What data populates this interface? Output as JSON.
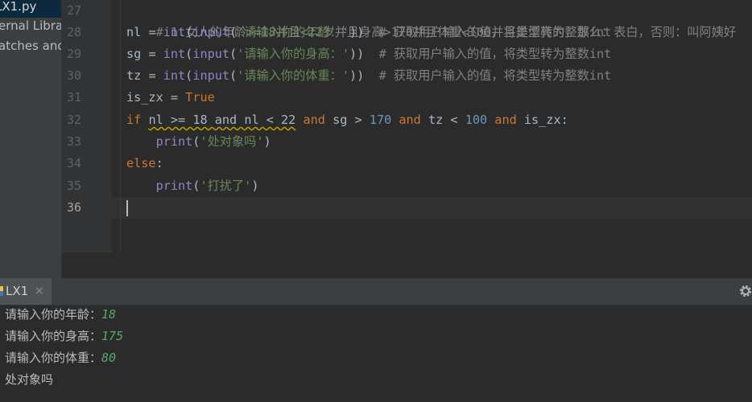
{
  "project_tree": {
    "items": [
      {
        "label": "LX1.py",
        "selected": true
      },
      {
        "label": "ernal Librar",
        "selected": false
      },
      {
        "label": "atches and",
        "selected": false
      }
    ]
  },
  "editor": {
    "line_numbers": [
      "27",
      "28",
      "29",
      "30",
      "31",
      "32",
      "33",
      "34",
      "35",
      "36"
    ],
    "current_line": "36",
    "lines": {
      "l27": {
        "comment": "# 1.女人的年龄>=18并且<22岁并且身高>170并且体重<100并且是漂亮的，那么：表白，否则：叫阿姨好"
      },
      "l28": {
        "var": "nl",
        "eq": " = ",
        "f1": "int",
        "p1": "(",
        "f2": "input",
        "p2": "(",
        "str": "'请输入你的年龄：'",
        "p3": "))",
        "comment": "  # 获取用户输入的值，将类型转为整数int"
      },
      "l29": {
        "var": "sg",
        "eq": " = ",
        "f1": "int",
        "p1": "(",
        "f2": "input",
        "p2": "(",
        "str": "'请输入你的身高：'",
        "p3": "))",
        "comment": "  # 获取用户输入的值，将类型转为整数int"
      },
      "l30": {
        "var": "tz",
        "eq": " = ",
        "f1": "int",
        "p1": "(",
        "f2": "input",
        "p2": "(",
        "str": "'请输入你的体重：'",
        "p3": "))",
        "comment": "  # 获取用户输入的值，将类型转为整数int"
      },
      "l31": {
        "var": "is_zx",
        "eq": " = ",
        "val": "True"
      },
      "l32": {
        "kw_if": "if",
        "cond_warn": "nl >= 18 and nl < 22",
        "sp1": " ",
        "and1": "and",
        "part2": " sg > ",
        "n170": "170",
        "sp2": " ",
        "and2": "and",
        "part3": " tz < ",
        "n100": "100",
        "sp3": " ",
        "and3": "and",
        "part4": " is_zx:"
      },
      "l33": {
        "indent": "    ",
        "fn": "print",
        "p1": "(",
        "str": "'处对象吗'",
        "p2": ")"
      },
      "l34": {
        "kw": "else",
        "colon": ":"
      },
      "l35": {
        "indent": "    ",
        "fn": "print",
        "p1": "(",
        "str": "'打扰了'",
        "p2": ")"
      }
    }
  },
  "run_panel": {
    "tab_label": "LX1",
    "tab_close": "×",
    "output": [
      {
        "prompt": "请输入你的年龄：",
        "input": "18"
      },
      {
        "prompt": "请输入你的身高：",
        "input": "175"
      },
      {
        "prompt": "请输入你的体重：",
        "input": "80"
      },
      {
        "prompt": "处对象吗",
        "input": ""
      }
    ]
  },
  "icons": {
    "run_tab": "python-run-icon",
    "settings": "gear-icon"
  }
}
